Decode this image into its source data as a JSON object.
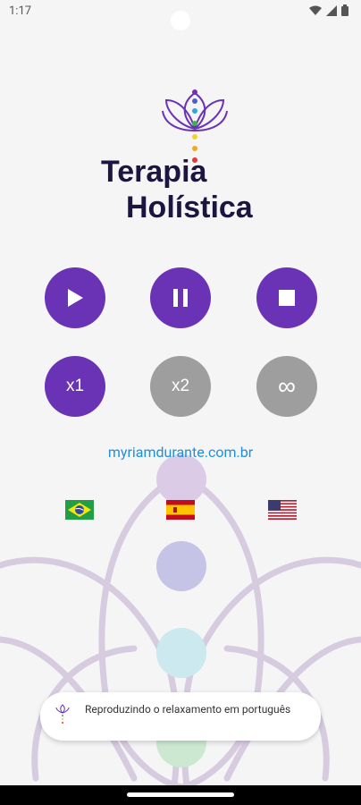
{
  "status_bar": {
    "time": "1:17",
    "icons": [
      "wifi-icon",
      "signal-icon",
      "battery-icon"
    ]
  },
  "logo": {
    "line1": "Terapia",
    "line2": "Holística",
    "text_color": "#1c1540",
    "chakra_colors": [
      "#6a33b6",
      "#4b5fd1",
      "#2fa7d9",
      "#3bb34a",
      "#f2d22e",
      "#f5a623",
      "#e53935"
    ]
  },
  "controls": {
    "play_icon": "play-icon",
    "pause_icon": "pause-icon",
    "stop_icon": "stop-icon",
    "speed_x1": "x1",
    "speed_x2": "x2",
    "loop_symbol": "∞",
    "active_color": "#6a33b6",
    "inactive_color": "#9e9e9e"
  },
  "website": "myriamdurante.com.br",
  "languages": [
    {
      "code": "pt-br",
      "icon": "brazil-flag-icon"
    },
    {
      "code": "es",
      "icon": "spain-flag-icon"
    },
    {
      "code": "en-us",
      "icon": "usa-flag-icon"
    }
  ],
  "toast": {
    "message": "Reproduzindo o relaxamento em português"
  }
}
